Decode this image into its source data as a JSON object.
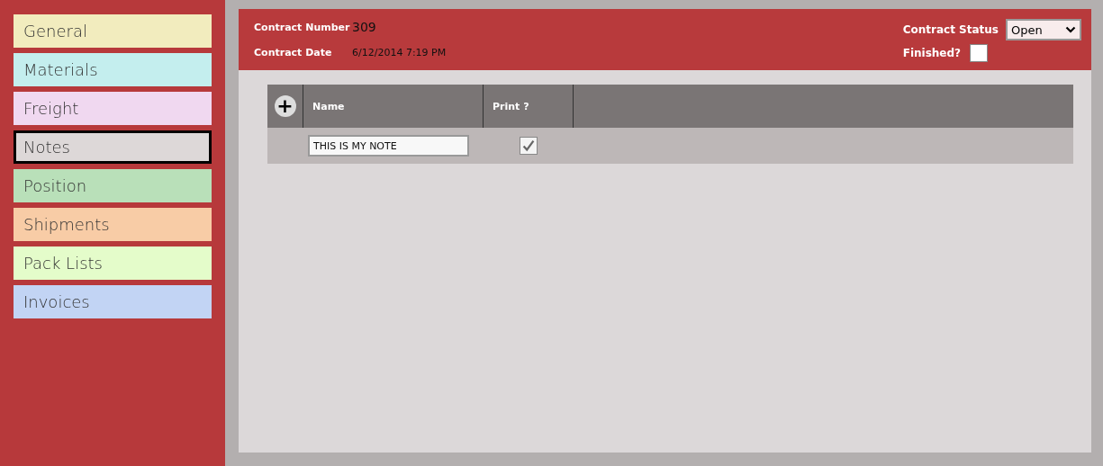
{
  "sidebar": {
    "items": [
      {
        "label": "General",
        "color": "#f2ecbe",
        "selected": false
      },
      {
        "label": "Materials",
        "color": "#c4eeee",
        "selected": false
      },
      {
        "label": "Freight",
        "color": "#f0d8f0",
        "selected": false
      },
      {
        "label": "Notes",
        "color": "#ddd8d8",
        "selected": true
      },
      {
        "label": "Position",
        "color": "#b9e0b9",
        "selected": false
      },
      {
        "label": "Shipments",
        "color": "#f8cca6",
        "selected": false
      },
      {
        "label": "Pack Lists",
        "color": "#e4fcca",
        "selected": false
      },
      {
        "label": "Invoices",
        "color": "#c2d4f4",
        "selected": false
      }
    ]
  },
  "header": {
    "contract_number_label": "Contract Number",
    "contract_number": "309",
    "contract_date_label": "Contract Date",
    "contract_date": "6/12/2014 7:19 PM",
    "status_label": "Contract Status",
    "status": "Open",
    "finished_label": "Finished?",
    "finished": false
  },
  "table": {
    "add_button": "+",
    "columns": [
      "Name",
      "Print ?"
    ],
    "rows": [
      {
        "name": "THIS IS MY NOTE",
        "print": true
      }
    ]
  }
}
